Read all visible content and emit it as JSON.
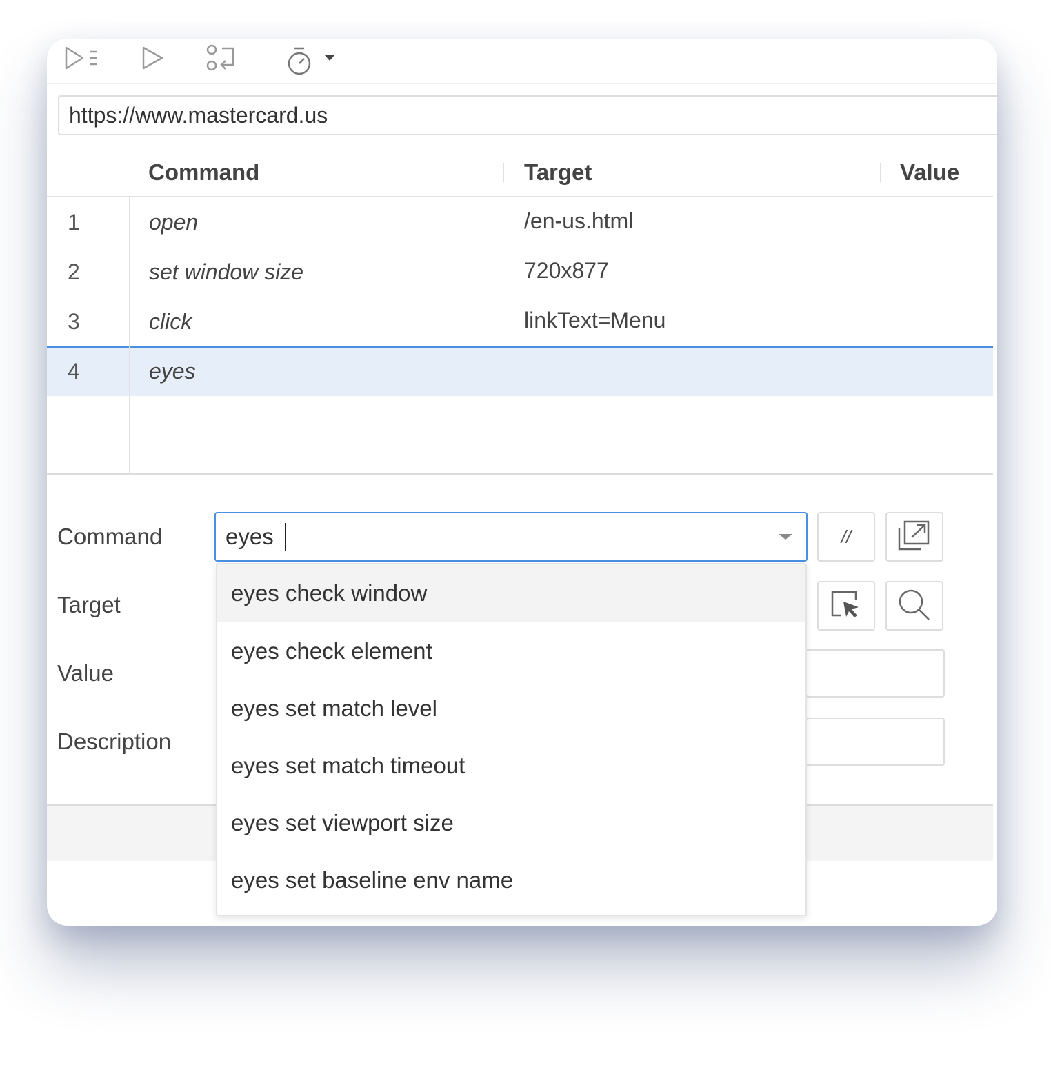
{
  "toolbar": {
    "icons": [
      "run-all-icon",
      "run-icon",
      "step-icon",
      "speed-timer-icon",
      "caret-down-icon"
    ]
  },
  "url": "https://www.mastercard.us",
  "table": {
    "headers": {
      "command": "Command",
      "target": "Target",
      "value": "Value"
    },
    "rows": [
      {
        "num": "1",
        "command": "open",
        "target": "/en-us.html"
      },
      {
        "num": "2",
        "command": "set window size",
        "target": "720x877"
      },
      {
        "num": "3",
        "command": "click",
        "target": "linkText=Menu"
      },
      {
        "num": "4",
        "command": "eyes",
        "target": ""
      }
    ],
    "selected_row": "4"
  },
  "editor": {
    "labels": {
      "command": "Command",
      "target": "Target",
      "value": "Value",
      "description": "Description"
    },
    "command_value": "eyes",
    "comment_button": "//"
  },
  "autocomplete": {
    "items": [
      "eyes check window",
      "eyes check element",
      "eyes set match level",
      "eyes set match timeout",
      "eyes set viewport size",
      "eyes set baseline env name"
    ],
    "highlighted_index": 0
  },
  "colors": {
    "accent": "#4a90e2",
    "selected_row_bg": "#e6eff9",
    "highlight_bg": "#f3f3f3"
  }
}
